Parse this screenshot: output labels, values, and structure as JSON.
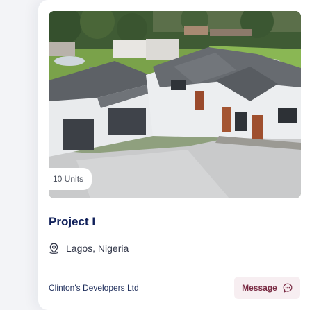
{
  "card": {
    "units_badge": "10 Units",
    "title": "Project I",
    "location": "Lagos, Nigeria",
    "developer": "Clinton's Developers Ltd",
    "message_label": "Message",
    "icons": {
      "location": "map-pin-icon",
      "message": "chat-bubble-icon"
    }
  },
  "colors": {
    "title": "#10205a",
    "accent_button_bg": "#f7eef1",
    "accent_button_text": "#7a2b43"
  }
}
